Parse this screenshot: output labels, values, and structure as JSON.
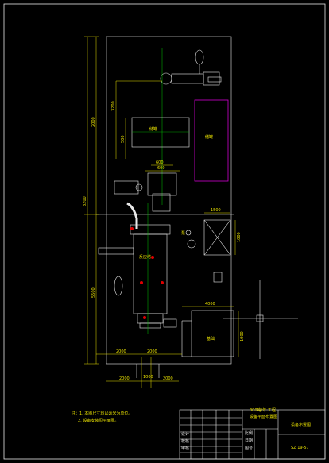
{
  "dimensions": {
    "total_height": "3200",
    "top_height": "3200",
    "left_upper": "2000",
    "left_lower": "5500",
    "tank_w": "2000",
    "mid_w": "1500",
    "pump_w": "600",
    "right_w": "1500",
    "right_h": "1000",
    "base_w": "4000",
    "base_h": "1000",
    "bottom_left": "2000",
    "bottom_mid": "2000",
    "bottom_span_left": "2000",
    "bottom_span_right": "2000",
    "small_a": "1000",
    "small_b": "1000",
    "side_a": "500",
    "side_b": "500",
    "mid_small": "600"
  },
  "labels": {
    "tank_label": "储罐",
    "magenta_label": "储罐",
    "column_label": "反应塔",
    "base_label": "基础",
    "side_label": "泵",
    "notes": [
      "注：1. 本图尺寸均以毫米为单位。",
      "2. 设备安装见平面图。"
    ],
    "title_main_1": "300吨/年 工程",
    "title_main_2": "设备平面布置图",
    "title_right": "设备布置图",
    "drawing_no": "SZ 19-57",
    "title_cells": [
      "设计",
      "校核",
      "审核",
      "比例",
      "日期",
      "图号"
    ]
  },
  "colors": {
    "frame": "#e8e8e8",
    "dimension": "#e8e000",
    "equipment": "#e8e8e8",
    "centerline": "#00c800",
    "magenta": "#d000d0",
    "red_marker": "#e00000"
  }
}
